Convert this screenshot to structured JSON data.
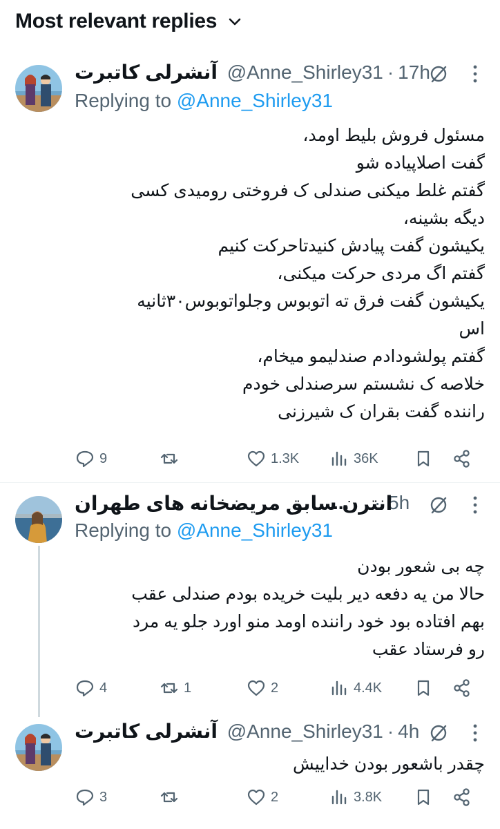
{
  "header": {
    "title": "Most relevant replies"
  },
  "tweets": [
    {
      "name": "آنشرلی کاتبرت",
      "handle": "@Anne_Shirley31",
      "time": "17h",
      "replying_label": "Replying to",
      "replying_handle": "@Anne_Shirley31",
      "lines": [
        "مسئول فروش بلیط اومد،",
        "گفت اصلاپیاده شو",
        "گفتم غلط میکنی صندلی ک فروختی رومیدی کسی",
        "دیگه بشینه،",
        "یکیشون گفت پیادش کنیدتاحرکت کنیم",
        "گفتم اگ مردی حرکت میکنی،",
        "یکیشون گفت فرق ته اتوبوس وجلواتوبوس۳۰ثانیه",
        "اس",
        "گفتم پولشودادم صندلیمو میخام،",
        "خلاصه ک نشستم سرصندلی خودم",
        "راننده گفت بقران ک شیرزنی"
      ],
      "replies": "9",
      "reposts": "",
      "likes": "1.3K",
      "views": "36K"
    },
    {
      "name": "انترن سابق مریضخانه های طهران",
      "ellipsis": "...",
      "time": "5h",
      "replying_label": "Replying to",
      "replying_handle": "@Anne_Shirley31",
      "lines": [
        "چه بی شعور بودن",
        "حالا من یه دفعه دیر بلیت خریده بودم صندلی عقب",
        "بهم افتاده بود خود راننده اومد منو اورد جلو یه مرد",
        "رو فرستاد عقب"
      ],
      "replies": "4",
      "reposts": "1",
      "likes": "2",
      "views": "4.4K"
    },
    {
      "name": "آنشرلی کاتبرت",
      "handle": "@Anne_Shirley31",
      "time": "4h",
      "lines": [
        "چقدر باشعور بودن خداییش"
      ],
      "replies": "3",
      "reposts": "",
      "likes": "2",
      "views": "3.8K"
    }
  ],
  "colors": {
    "text": "#0f1419",
    "secondary": "#536471",
    "link": "#1d9bf0",
    "border": "#eff3f4"
  }
}
